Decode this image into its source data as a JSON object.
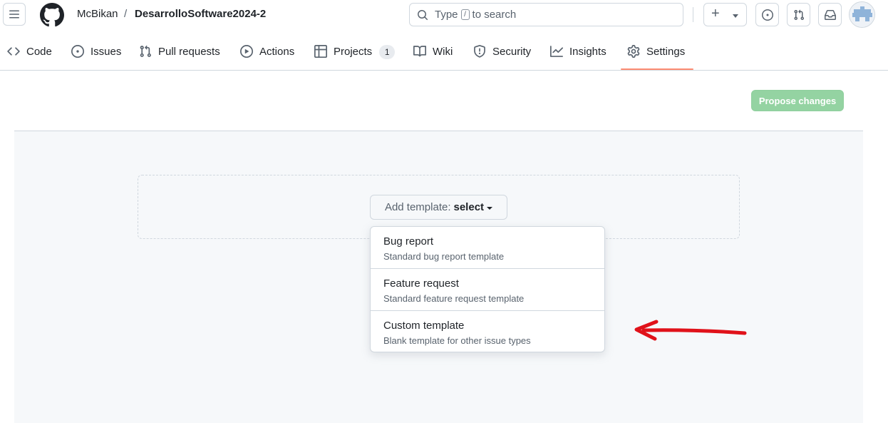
{
  "header": {
    "owner": "McBikan",
    "separator": "/",
    "repo": "DesarrolloSoftware2024-2",
    "search_prefix": "Type",
    "search_key": "/",
    "search_suffix": "to search",
    "icons": [
      "hamburger-icon",
      "github-logo",
      "search-icon",
      "plus-icon",
      "issue-icon",
      "pull-request-icon",
      "inbox-icon"
    ]
  },
  "nav": {
    "tabs": [
      {
        "label": "Code",
        "icon": "code-icon"
      },
      {
        "label": "Issues",
        "icon": "issue-icon"
      },
      {
        "label": "Pull requests",
        "icon": "pull-request-icon"
      },
      {
        "label": "Actions",
        "icon": "play-icon"
      },
      {
        "label": "Projects",
        "icon": "table-icon",
        "count": "1"
      },
      {
        "label": "Wiki",
        "icon": "book-icon"
      },
      {
        "label": "Security",
        "icon": "shield-icon"
      },
      {
        "label": "Insights",
        "icon": "graph-icon"
      },
      {
        "label": "Settings",
        "icon": "gear-icon",
        "active": true
      }
    ]
  },
  "toolbar": {
    "propose_label": "Propose changes"
  },
  "template_picker": {
    "prefix": "Add template:",
    "selected": "select",
    "options": [
      {
        "title": "Bug report",
        "description": "Standard bug report template"
      },
      {
        "title": "Feature request",
        "description": "Standard feature request template"
      },
      {
        "title": "Custom template",
        "description": "Blank template for other issue types"
      }
    ]
  },
  "colors": {
    "accent_underline": "#fd8c73",
    "propose_button": "#94d3a2",
    "annotation_arrow": "#e0121a"
  }
}
